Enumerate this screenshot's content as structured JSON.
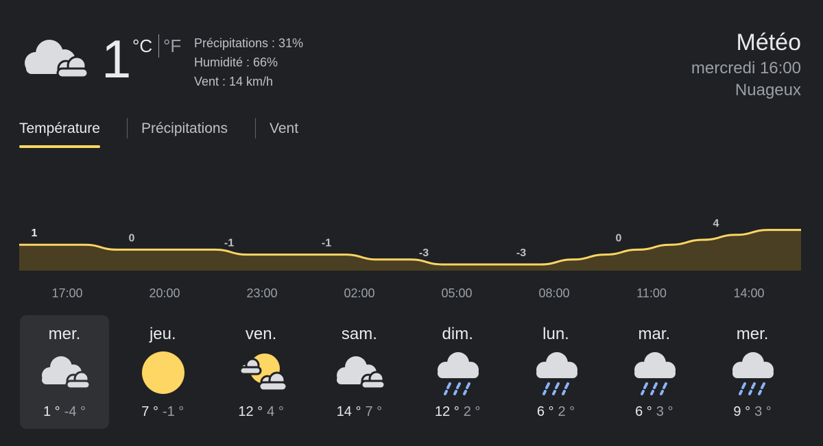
{
  "current": {
    "icon": "cloudy-icon",
    "temp": "1",
    "unit_c": "°C",
    "unit_f": "°F",
    "precip": "Précipitations : 31%",
    "humidity": "Humidité : 66%",
    "wind": "Vent : 14 km/h"
  },
  "header": {
    "title": "Météo",
    "datetime": "mercredi 16:00",
    "condition": "Nuageux"
  },
  "tabs": [
    {
      "label": "Température",
      "active": true
    },
    {
      "label": "Précipitations",
      "active": false
    },
    {
      "label": "Vent",
      "active": false
    }
  ],
  "chart_data": {
    "type": "area",
    "x": [
      "16:00",
      "17:00",
      "18:00",
      "19:00",
      "20:00",
      "21:00",
      "22:00",
      "23:00",
      "00:00",
      "01:00",
      "02:00",
      "03:00",
      "04:00",
      "05:00",
      "06:00",
      "07:00",
      "08:00",
      "09:00",
      "10:00",
      "11:00",
      "12:00",
      "13:00",
      "14:00",
      "15:00",
      "16:00"
    ],
    "values": [
      1,
      1,
      1,
      0,
      0,
      0,
      0,
      -1,
      -1,
      -1,
      -1,
      -2,
      -2,
      -3,
      -3,
      -3,
      -3,
      -2,
      -1,
      0,
      1,
      2,
      3,
      4,
      4
    ],
    "labels": [
      {
        "x": "17:00",
        "value": "1"
      },
      {
        "x": "20:00",
        "value": "0"
      },
      {
        "x": "23:00",
        "value": "-1"
      },
      {
        "x": "02:00",
        "value": "-1"
      },
      {
        "x": "05:00",
        "value": "-3"
      },
      {
        "x": "08:00",
        "value": "-3"
      },
      {
        "x": "11:00",
        "value": "0"
      },
      {
        "x": "14:00",
        "value": "4"
      }
    ],
    "tick_labels": [
      "17:00",
      "20:00",
      "23:00",
      "02:00",
      "05:00",
      "08:00",
      "11:00",
      "14:00"
    ],
    "line_color": "#fdd663",
    "fill_color": "#4a3f22"
  },
  "days": [
    {
      "name": "mer.",
      "icon": "cloudy-icon",
      "hi": "1 °",
      "lo": "-4 °",
      "selected": true
    },
    {
      "name": "jeu.",
      "icon": "sunny-icon",
      "hi": "7 °",
      "lo": "-1 °",
      "selected": false
    },
    {
      "name": "ven.",
      "icon": "partly-cloudy-icon",
      "hi": "12 °",
      "lo": "4 °",
      "selected": false
    },
    {
      "name": "sam.",
      "icon": "cloudy-icon",
      "hi": "14 °",
      "lo": "7 °",
      "selected": false
    },
    {
      "name": "dim.",
      "icon": "rain-icon",
      "hi": "12 °",
      "lo": "2 °",
      "selected": false
    },
    {
      "name": "lun.",
      "icon": "rain-icon",
      "hi": "6 °",
      "lo": "2 °",
      "selected": false
    },
    {
      "name": "mar.",
      "icon": "rain-icon",
      "hi": "6 °",
      "lo": "3 °",
      "selected": false
    },
    {
      "name": "mer.",
      "icon": "rain-icon",
      "hi": "9 °",
      "lo": "3 °",
      "selected": false
    }
  ],
  "colors": {
    "background": "#202124",
    "accent": "#fdd663",
    "text": "#e8eaed",
    "muted": "#9aa0a6",
    "rain": "#8ab4f8"
  }
}
